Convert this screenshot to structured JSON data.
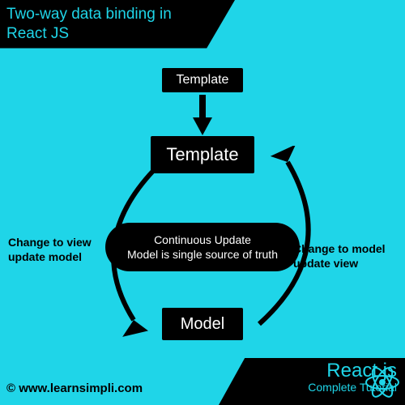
{
  "title": "Two-way data binding in React JS",
  "nodes": {
    "template_top": "Template",
    "template_main": "Template",
    "model": "Model"
  },
  "center": {
    "line1": "Continuous Update",
    "line2": "Model is single source of truth"
  },
  "labels": {
    "left_line1": "Change to view",
    "left_line2": "update model",
    "right_line1": "Change to model",
    "right_line2": "update view"
  },
  "footer": {
    "copyright": "©  www.learnsimpli.com",
    "brand": "React js",
    "subtitle": "Complete Tutorial"
  },
  "colors": {
    "bg": "#1fd5e8",
    "ink": "#000000",
    "accent": "#1fd5e8"
  }
}
